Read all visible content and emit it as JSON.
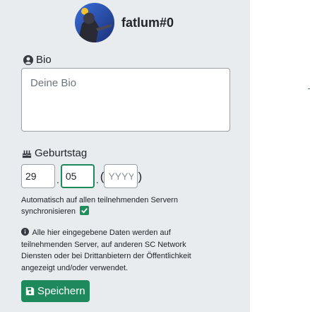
{
  "profile": {
    "username": "fatlum#0"
  },
  "bio": {
    "label": "Bio",
    "placeholder": "Deine Bio"
  },
  "birthday": {
    "label": "Geburtstag",
    "day_value": "29",
    "month_value": "05",
    "year_placeholder": "YYYY",
    "separator": "."
  },
  "sync": {
    "text": "Automatisch auf allen teilnehmenden Servern synchronisieren",
    "checked": true
  },
  "notice": {
    "text": "Alle hier eingegebene Daten werden auf teilnehmenden Server, auf anderen SC Network Diensten oder bei Drittanbietern der Öffentlichkeit angezeigt und/oder verwendet."
  },
  "actions": {
    "save_label": "Speichern"
  },
  "colors": {
    "accent": "#1e8a5c",
    "panel_bg": "#e9ecef"
  },
  "icons": [
    "user-circle-icon",
    "cake-icon",
    "check-icon",
    "info-icon",
    "floppy-disk-icon"
  ]
}
